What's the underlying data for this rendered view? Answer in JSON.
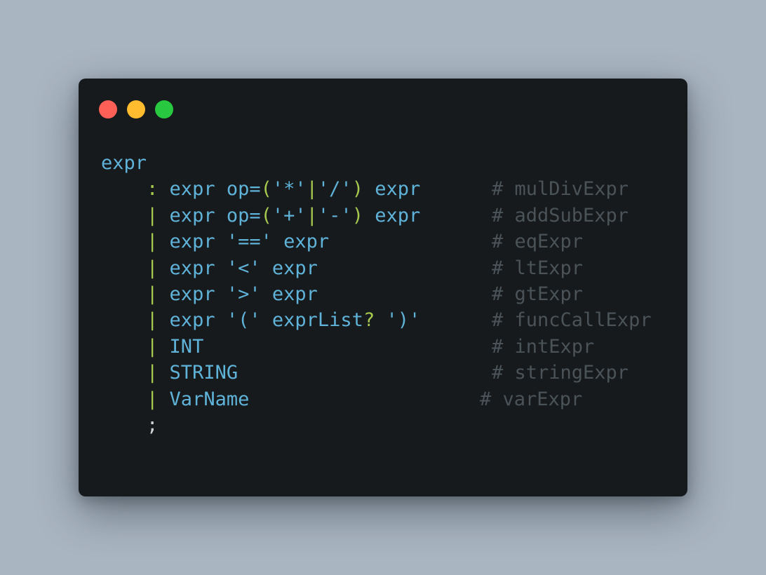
{
  "window": {
    "controls": [
      {
        "name": "close",
        "color": "#fe5f57"
      },
      {
        "name": "minimize",
        "color": "#febc2e"
      },
      {
        "name": "maximize",
        "color": "#28c840"
      }
    ]
  },
  "code": {
    "lines": [
      {
        "parts": [
          {
            "t": "expr",
            "k": "ident"
          }
        ],
        "comment": ""
      },
      {
        "parts": [
          {
            "t": "    ",
            "k": "ws"
          },
          {
            "t": ":",
            "k": "kw"
          },
          {
            "t": " expr op=",
            "k": "ident"
          },
          {
            "t": "(",
            "k": "kw"
          },
          {
            "t": "'*'",
            "k": "lit"
          },
          {
            "t": "|",
            "k": "kw"
          },
          {
            "t": "'/'",
            "k": "lit"
          },
          {
            "t": ")",
            "k": "kw"
          },
          {
            "t": " expr",
            "k": "ident"
          }
        ],
        "comment": "# mulDivExpr"
      },
      {
        "parts": [
          {
            "t": "    ",
            "k": "ws"
          },
          {
            "t": "|",
            "k": "kw"
          },
          {
            "t": " expr op=",
            "k": "ident"
          },
          {
            "t": "(",
            "k": "kw"
          },
          {
            "t": "'+'",
            "k": "lit"
          },
          {
            "t": "|",
            "k": "kw"
          },
          {
            "t": "'-'",
            "k": "lit"
          },
          {
            "t": ")",
            "k": "kw"
          },
          {
            "t": " expr",
            "k": "ident"
          }
        ],
        "comment": "# addSubExpr"
      },
      {
        "parts": [
          {
            "t": "    ",
            "k": "ws"
          },
          {
            "t": "|",
            "k": "kw"
          },
          {
            "t": " expr ",
            "k": "ident"
          },
          {
            "t": "'=='",
            "k": "lit"
          },
          {
            "t": " expr",
            "k": "ident"
          }
        ],
        "comment": "# eqExpr"
      },
      {
        "parts": [
          {
            "t": "    ",
            "k": "ws"
          },
          {
            "t": "|",
            "k": "kw"
          },
          {
            "t": " expr ",
            "k": "ident"
          },
          {
            "t": "'<'",
            "k": "lit"
          },
          {
            "t": " expr",
            "k": "ident"
          }
        ],
        "comment": "# ltExpr"
      },
      {
        "parts": [
          {
            "t": "    ",
            "k": "ws"
          },
          {
            "t": "|",
            "k": "kw"
          },
          {
            "t": " expr ",
            "k": "ident"
          },
          {
            "t": "'>'",
            "k": "lit"
          },
          {
            "t": " expr",
            "k": "ident"
          }
        ],
        "comment": "# gtExpr"
      },
      {
        "parts": [
          {
            "t": "    ",
            "k": "ws"
          },
          {
            "t": "|",
            "k": "kw"
          },
          {
            "t": " expr ",
            "k": "ident"
          },
          {
            "t": "'('",
            "k": "lit"
          },
          {
            "t": " exprList",
            "k": "ident"
          },
          {
            "t": "?",
            "k": "kw"
          },
          {
            "t": " ",
            "k": "ident"
          },
          {
            "t": "')'",
            "k": "lit"
          }
        ],
        "comment": "# funcCallExpr"
      },
      {
        "parts": [
          {
            "t": "    ",
            "k": "ws"
          },
          {
            "t": "|",
            "k": "kw"
          },
          {
            "t": " INT",
            "k": "ident"
          }
        ],
        "comment": "# intExpr"
      },
      {
        "parts": [
          {
            "t": "    ",
            "k": "ws"
          },
          {
            "t": "|",
            "k": "kw"
          },
          {
            "t": " STRING",
            "k": "ident"
          }
        ],
        "comment": "# stringExpr"
      },
      {
        "parts": [
          {
            "t": "    ",
            "k": "ws"
          },
          {
            "t": "|",
            "k": "kw"
          },
          {
            "t": " VarName",
            "k": "ident"
          }
        ],
        "comment": "# varExpr"
      },
      {
        "parts": [
          {
            "t": "    ",
            "k": "ws"
          },
          {
            "t": ";",
            "k": "punct"
          }
        ],
        "comment": ""
      }
    ]
  },
  "colors": {
    "background": "#a9b5c1",
    "window": "#171a1d",
    "ident": "#5fb3d9",
    "kw": "#a6c94e",
    "punct": "#d0d3d6",
    "comment": "#4a5358"
  }
}
